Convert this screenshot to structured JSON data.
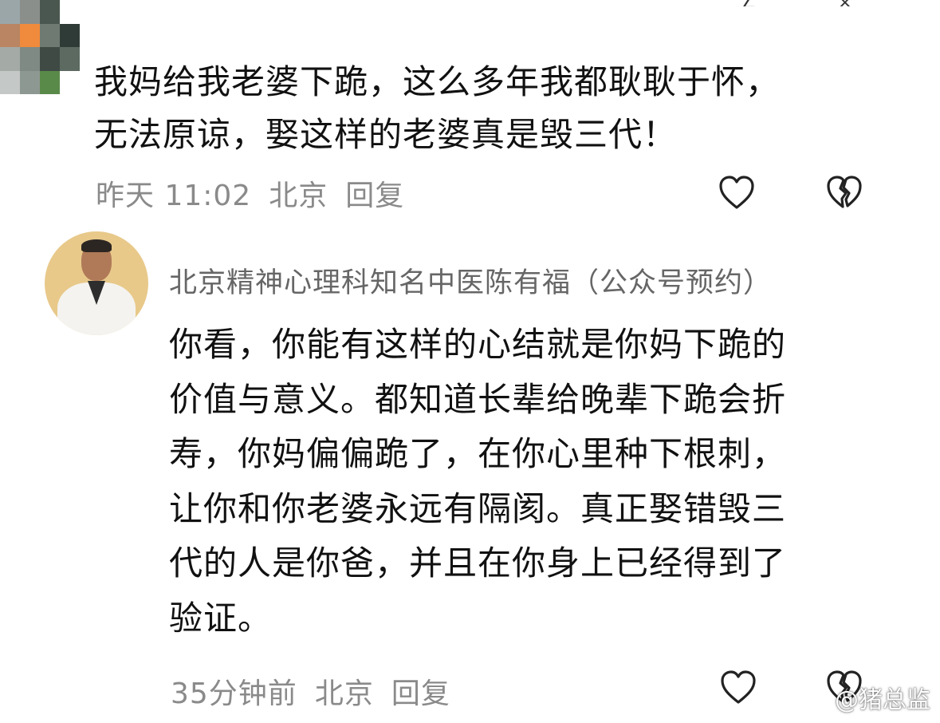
{
  "comments": [
    {
      "text_lines": [
        "我妈给我老婆下跪，这么多年我都耿耿于怀，",
        "无法原谅，娶这样的老婆真是毁三代！"
      ],
      "time": "昨天 11:02",
      "location": "北京",
      "reply_label": "回复",
      "avatar_icon": "pixelated-avatar",
      "like_icon": "heart-outline-icon",
      "dislike_icon": "broken-heart-icon"
    },
    {
      "author": "北京精神心理科知名中医陈有福（公众号预约）",
      "text_lines": [
        "你看，你能有这样的心结就是你妈下跪的",
        "价值与意义。都知道长辈给晚辈下跪会折",
        "寿，你妈偏偏跪了，在你心里种下根刺，",
        "让你和你老婆永远有隔阂。真正娶错毁三",
        "代的人是你爸，并且在你身上已经得到了",
        "验证。"
      ],
      "time": "35分钟前",
      "location": "北京",
      "reply_label": "回复",
      "avatar_icon": "doctor-avatar",
      "like_icon": "heart-outline-icon",
      "dislike_icon": "broken-heart-icon"
    }
  ],
  "watermark": "@猪总监",
  "colors": {
    "text": "#111111",
    "meta": "#8a8a8a",
    "author": "#666666",
    "background": "#ffffff"
  }
}
